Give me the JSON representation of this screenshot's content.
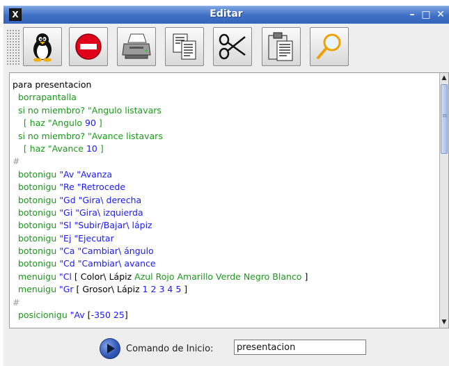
{
  "window": {
    "title": "Editar",
    "icon": "app-x-icon",
    "controls": [
      "minimize",
      "maximize",
      "close"
    ],
    "control_glyphs": {
      "minimize": "–",
      "maximize": "□",
      "close": "✕"
    }
  },
  "toolbar": {
    "buttons": [
      {
        "name": "linux-penguin",
        "icon": "penguin-icon"
      },
      {
        "name": "stop",
        "icon": "stop-icon"
      },
      {
        "name": "print",
        "icon": "printer-icon"
      },
      {
        "name": "copy",
        "icon": "copy-icon"
      },
      {
        "name": "cut",
        "icon": "scissors-icon"
      },
      {
        "name": "paste",
        "icon": "paste-icon"
      },
      {
        "name": "search",
        "icon": "magnifier-icon"
      }
    ]
  },
  "editor": {
    "lines": [
      [
        [
          "k",
          "para presentacion"
        ]
      ],
      [
        [
          "g",
          "  borrapantalla"
        ]
      ],
      [
        [
          "g",
          "  si no miembro? \"Angulo listavars"
        ]
      ],
      [
        [
          "g",
          "    [ haz \"Angulo "
        ],
        [
          "b",
          "90"
        ],
        [
          "g",
          " ]"
        ]
      ],
      [
        [
          "g",
          "  si no miembro? \"Avance listavars"
        ]
      ],
      [
        [
          "g",
          "    [ haz \"Avance "
        ],
        [
          "b",
          "10"
        ],
        [
          "g",
          " ]"
        ]
      ],
      [
        [
          "c",
          "#"
        ]
      ],
      [
        [
          "g",
          "  botonigu "
        ],
        [
          "b",
          "\"Av \"Avanza"
        ]
      ],
      [
        [
          "g",
          "  botonigu "
        ],
        [
          "b",
          "\"Re \"Retrocede"
        ]
      ],
      [
        [
          "g",
          "  botonigu "
        ],
        [
          "b",
          "\"Gd \"Gira\\ derecha"
        ]
      ],
      [
        [
          "g",
          "  botonigu "
        ],
        [
          "b",
          "\"Gi \"Gira\\ izquierda"
        ]
      ],
      [
        [
          "g",
          "  botonigu "
        ],
        [
          "b",
          "\"Sl \"Subir/Bajar\\ lápiz"
        ]
      ],
      [
        [
          "g",
          "  botonigu "
        ],
        [
          "b",
          "\"Ej \"Ejecutar"
        ]
      ],
      [
        [
          "g",
          "  botonigu "
        ],
        [
          "b",
          "\"Ca \"Cambiar\\ ángulo"
        ]
      ],
      [
        [
          "g",
          "  botonigu "
        ],
        [
          "b",
          "\"Cd \"Cambiar\\ avance"
        ]
      ],
      [
        [
          "g",
          "  menuigu "
        ],
        [
          "b",
          "\"Cl"
        ],
        [
          "k",
          " [ Color\\ Lápiz "
        ],
        [
          "g",
          "Azul Rojo Amarillo Verde Negro Blanco"
        ],
        [
          "k",
          " ]"
        ]
      ],
      [
        [
          "g",
          "  menuigu "
        ],
        [
          "b",
          "\"Gr"
        ],
        [
          "k",
          " [ Grosor\\ Lápiz "
        ],
        [
          "b",
          "1 2 3 4 5"
        ],
        [
          "k",
          " ]"
        ]
      ],
      [
        [
          "c",
          "#"
        ]
      ],
      [
        [
          "g",
          "  posicionigu "
        ],
        [
          "b",
          "\"Av"
        ],
        [
          "k",
          " ["
        ],
        [
          "b",
          "-350 25"
        ],
        [
          "k",
          "]"
        ]
      ]
    ]
  },
  "bottom": {
    "run_icon": "play-icon",
    "command_label": "Comando de Inicio:",
    "command_value": "presentacion"
  }
}
